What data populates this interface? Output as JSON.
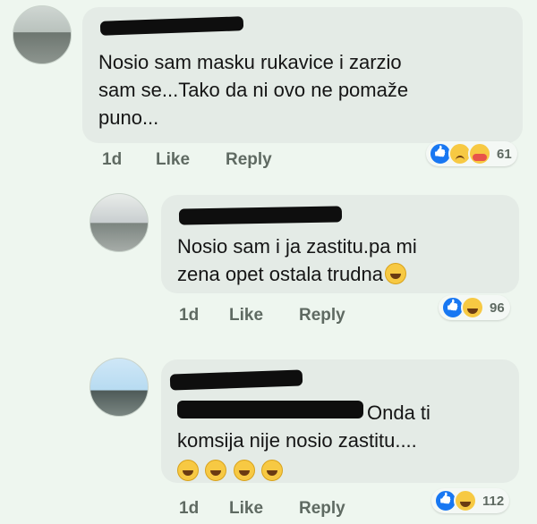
{
  "comments": [
    {
      "text_lines": [
        "Nosio sam masku  rukavice i zarzio",
        "sam se...Tako da ni ovo ne pomaže",
        "puno..."
      ],
      "time": "1d",
      "like_label": "Like",
      "reply_label": "Reply",
      "reactions": [
        "like-icon",
        "sad-icon",
        "care-icon"
      ],
      "reaction_count": "61"
    },
    {
      "text_lines": [
        "Nosio sam i ja zastitu.pa mi",
        "zena opet ostala trudna"
      ],
      "time": "1d",
      "like_label": "Like",
      "reply_label": "Reply",
      "reactions": [
        "like-icon",
        "haha-icon"
      ],
      "reaction_count": "96"
    },
    {
      "text_lines": [
        "Onda ti",
        "komsija nije nosio zastitu...."
      ],
      "time": "1d",
      "like_label": "Like",
      "reply_label": "Reply",
      "reactions": [
        "like-icon",
        "haha-icon"
      ],
      "reaction_count": "112"
    }
  ]
}
